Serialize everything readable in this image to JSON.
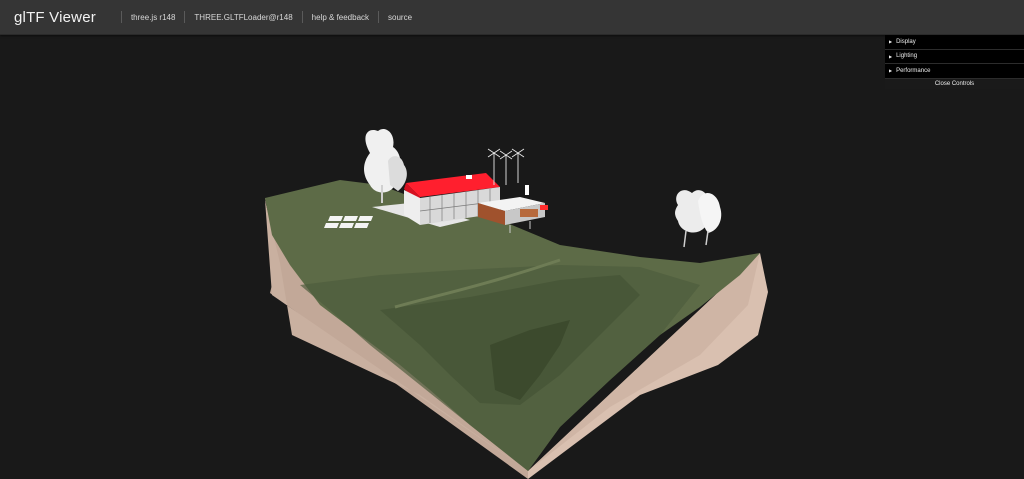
{
  "header": {
    "title": "glTF Viewer",
    "links": [
      {
        "label": "three.js r148"
      },
      {
        "label": "THREE.GLTFLoader@r148"
      },
      {
        "label": "help & feedback"
      },
      {
        "label": "source"
      }
    ]
  },
  "controls": {
    "folders": [
      {
        "label": "Display"
      },
      {
        "label": "Lighting"
      },
      {
        "label": "Performance"
      }
    ],
    "close_label": "Close Controls"
  },
  "scene": {
    "background": "#191919",
    "grass_color": "#5d6b47",
    "soil_color": "#c9b0a0",
    "roof_color": "#ff1f2e"
  }
}
